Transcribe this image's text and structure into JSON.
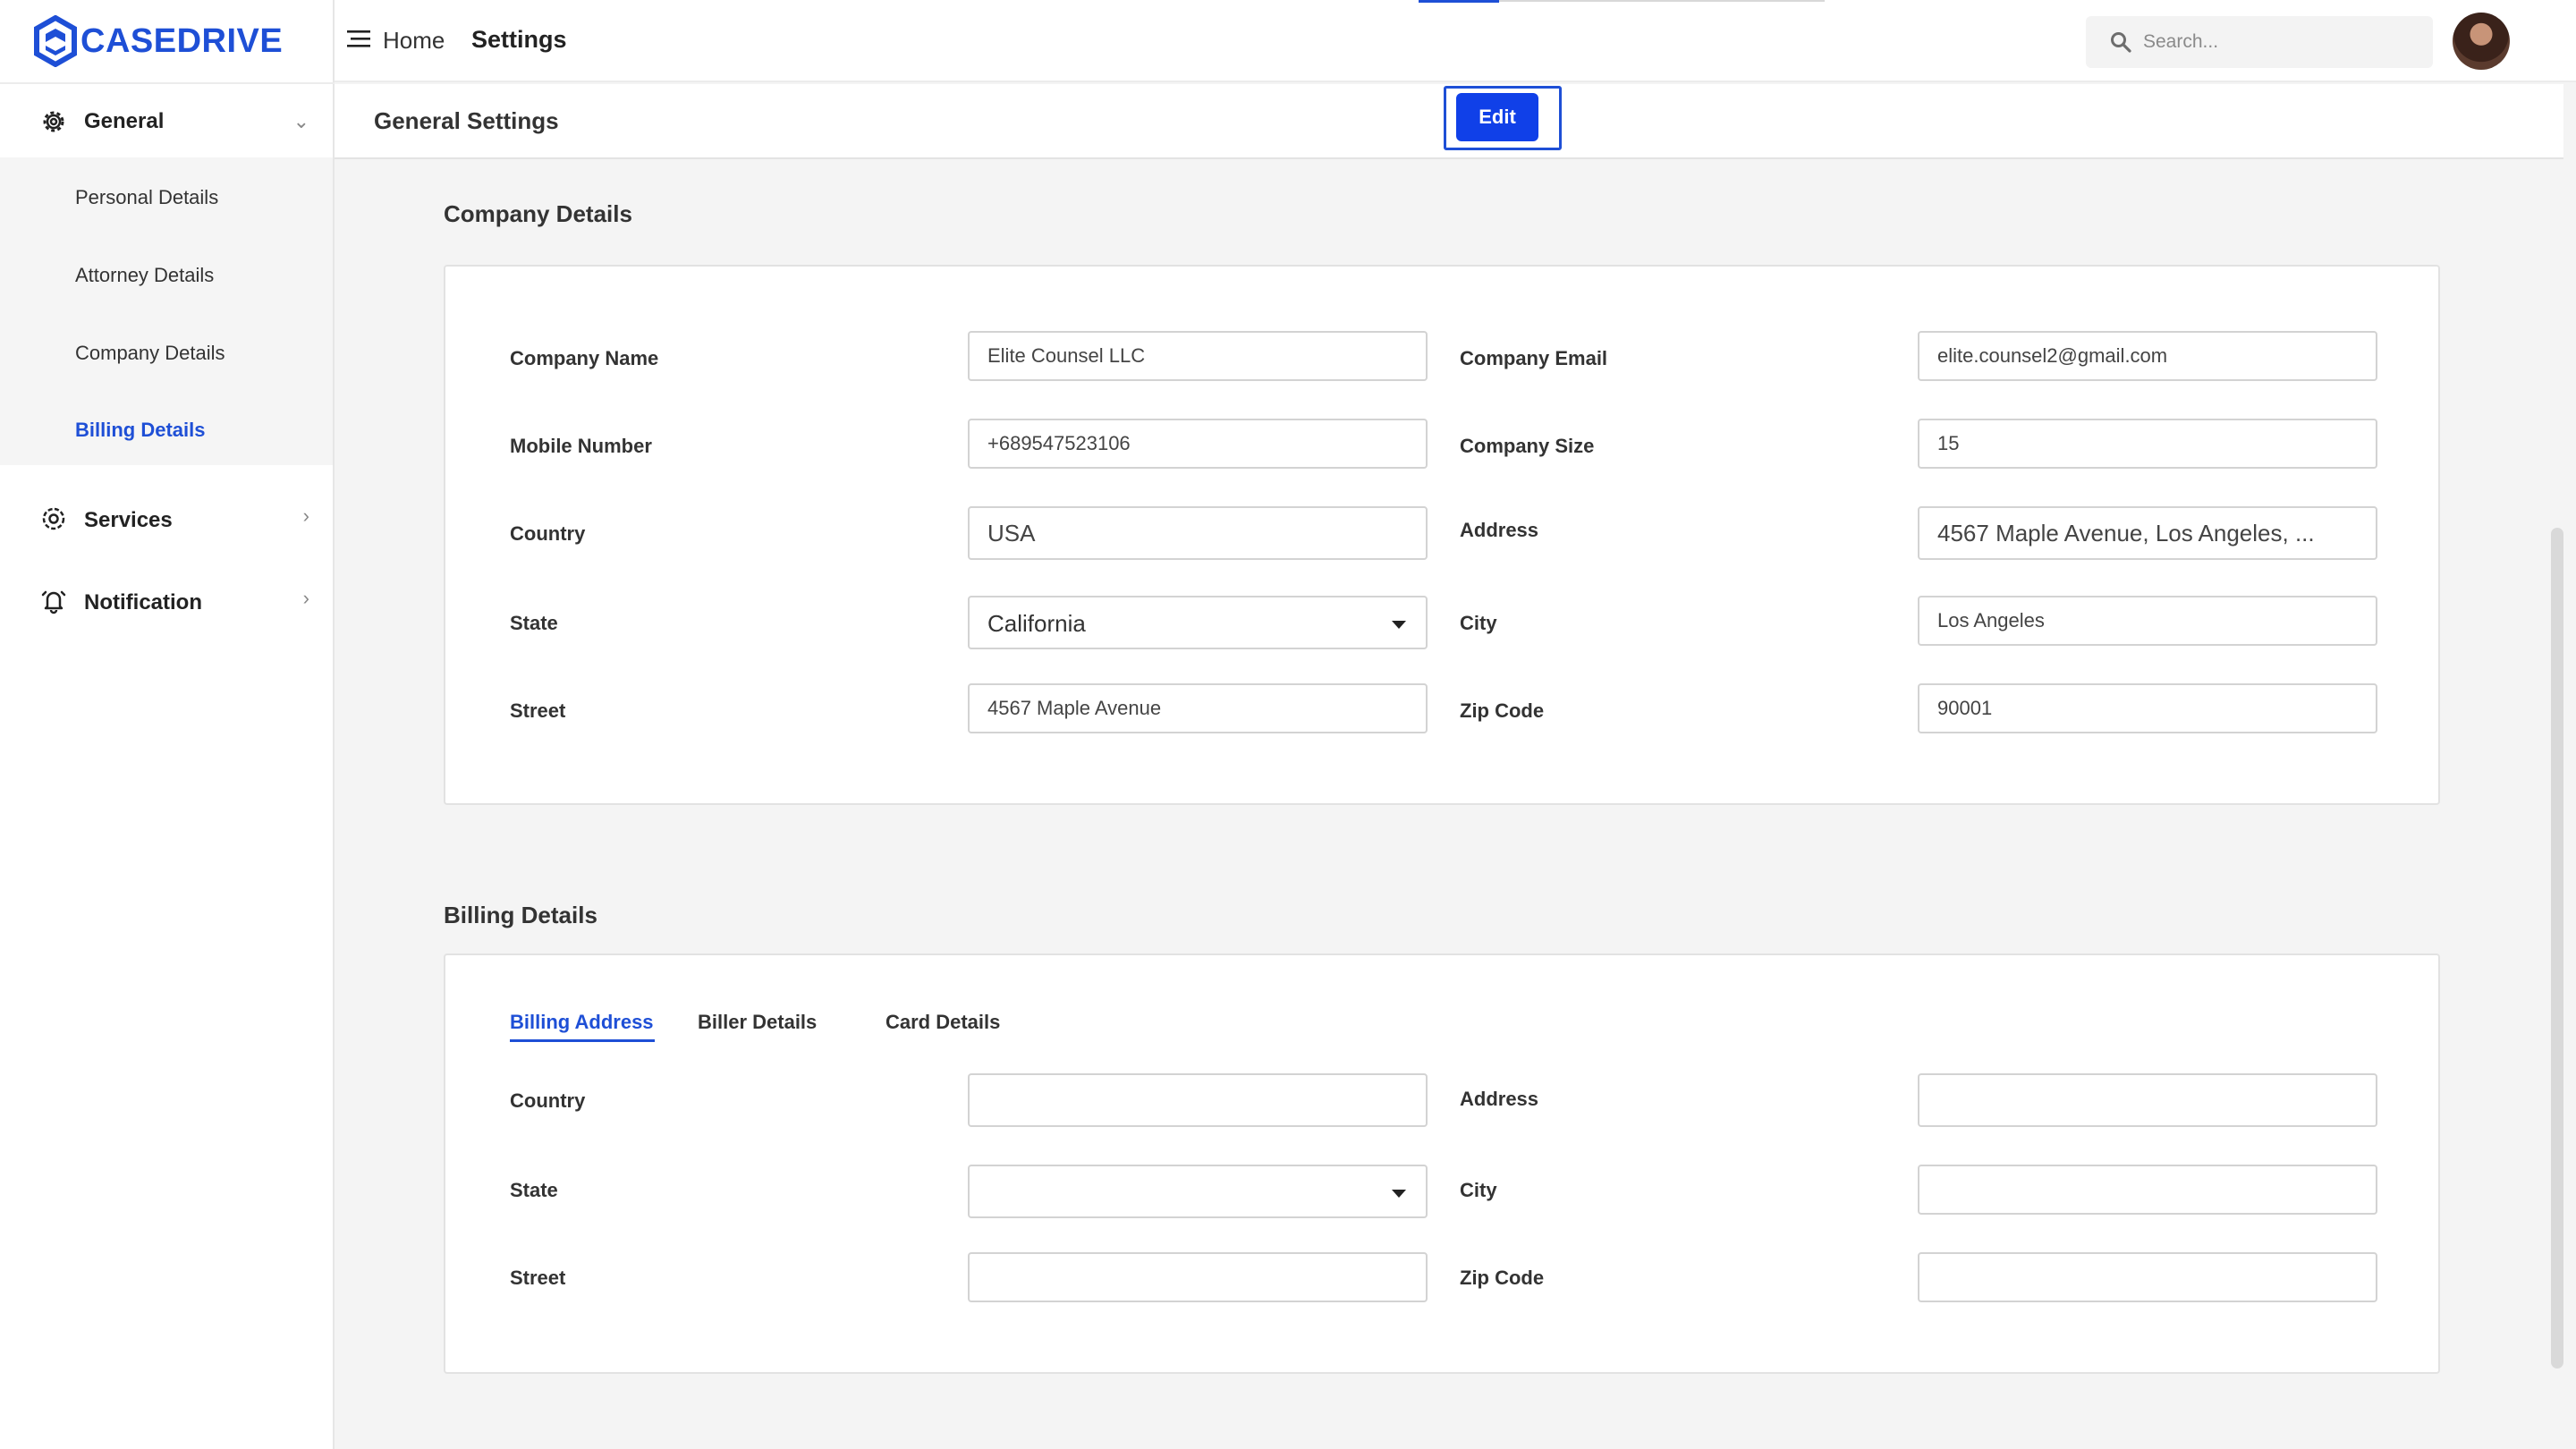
{
  "brand": {
    "name": "CASEDRIVE",
    "color": "#1e4fd6"
  },
  "header": {
    "breadcrumb_home": "Home",
    "breadcrumb_current": "Settings",
    "search_placeholder": "Search..."
  },
  "sidebar": {
    "general": {
      "label": "General",
      "icon": "gear-icon"
    },
    "sub_items": [
      {
        "label": "Personal Details",
        "active": false
      },
      {
        "label": "Attorney Details",
        "active": false
      },
      {
        "label": "Company Details",
        "active": false
      },
      {
        "label": "Billing Details",
        "active": true
      }
    ],
    "services": {
      "label": "Services",
      "icon": "services-gear-icon"
    },
    "notification": {
      "label": "Notification",
      "icon": "bell-icon"
    }
  },
  "page": {
    "title": "General Settings",
    "edit_label": "Edit"
  },
  "company": {
    "section_title": "Company Details",
    "fields": {
      "company_name": {
        "label": "Company Name",
        "value": "Elite Counsel LLC"
      },
      "company_email": {
        "label": "Company Email",
        "value": "elite.counsel2@gmail.com"
      },
      "mobile": {
        "label": "Mobile Number",
        "value": "+689547523106"
      },
      "size": {
        "label": "Company Size",
        "value": "15"
      },
      "country": {
        "label": "Country",
        "value": "USA"
      },
      "address": {
        "label": "Address",
        "value": "4567 Maple Avenue, Los Angeles, ..."
      },
      "state": {
        "label": "State",
        "value": "California"
      },
      "city": {
        "label": "City",
        "value": "Los Angeles"
      },
      "street": {
        "label": "Street",
        "value": "4567 Maple Avenue"
      },
      "zip": {
        "label": "Zip Code",
        "value": "90001"
      }
    }
  },
  "billing": {
    "section_title": "Billing Details",
    "tabs": [
      {
        "label": "Billing Address",
        "active": true
      },
      {
        "label": "Biller Details",
        "active": false
      },
      {
        "label": "Card Details",
        "active": false
      }
    ],
    "fields": {
      "country": {
        "label": "Country",
        "value": ""
      },
      "address": {
        "label": "Address",
        "value": ""
      },
      "state": {
        "label": "State",
        "value": ""
      },
      "city": {
        "label": "City",
        "value": ""
      },
      "street": {
        "label": "Street",
        "value": ""
      },
      "zip": {
        "label": "Zip Code",
        "value": ""
      }
    }
  }
}
